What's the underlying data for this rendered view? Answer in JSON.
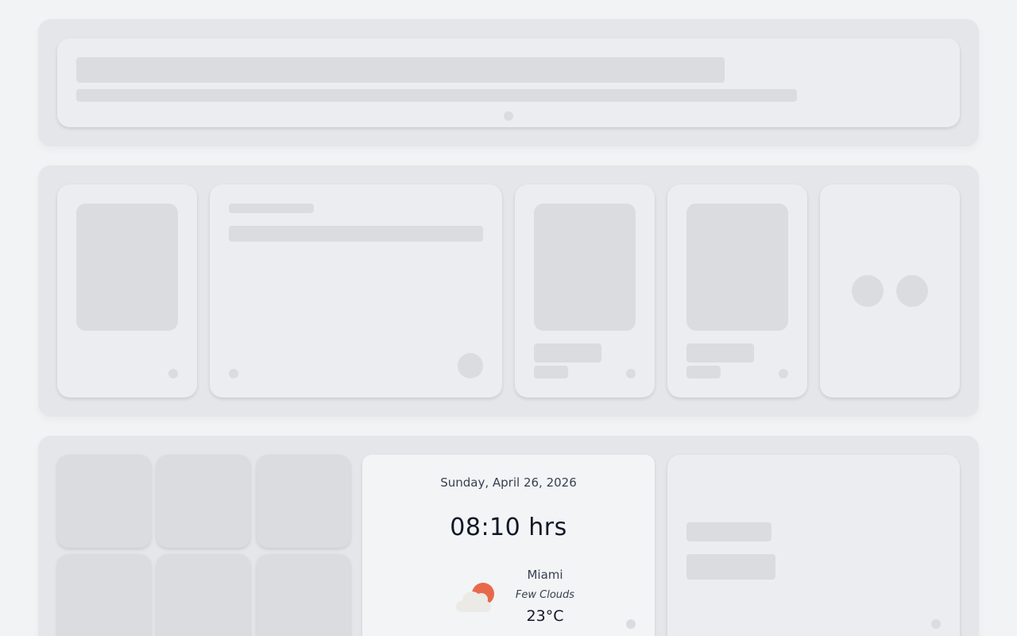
{
  "clock_widget": {
    "date": "Sunday, April 26, 2026",
    "time": "08:10 hrs"
  },
  "weather": {
    "city": "Miami",
    "description": "Few Clouds",
    "temperature": "23°C",
    "icon": "few-clouds-icon",
    "sun_color": "#e8694a",
    "cloud_color": "#eceae6"
  },
  "colors": {
    "page_background": "#f2f3f5",
    "section_background": "#e5e6e9",
    "card_background": "#ecedf0",
    "placeholder": "#dadce0"
  }
}
